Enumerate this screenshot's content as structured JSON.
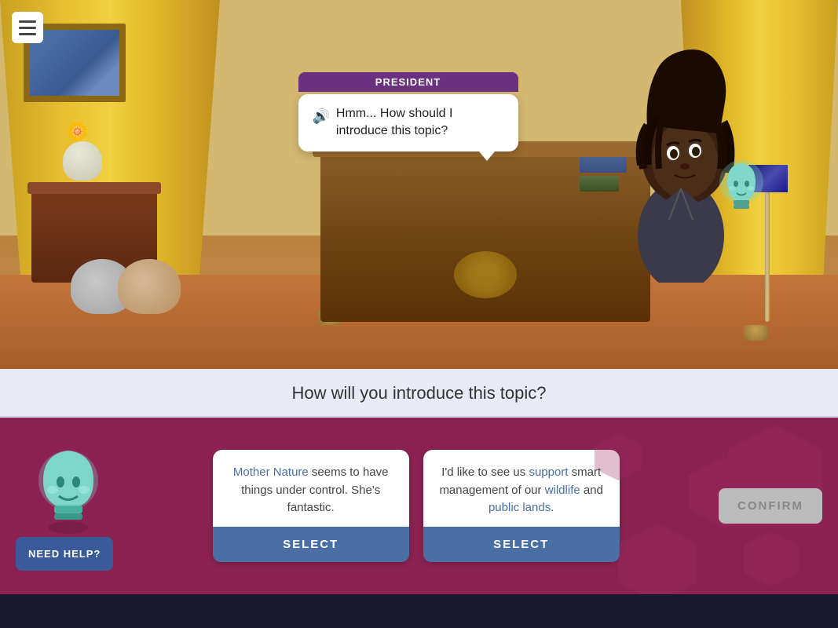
{
  "menu": {
    "label": "☰"
  },
  "scene": {
    "speaker": "PRESIDENT",
    "speech": "Hmm... How should I introduce this topic?",
    "sound_icon": "🔊"
  },
  "question": {
    "text": "How will you introduce this topic?"
  },
  "choices": [
    {
      "id": "choice-1",
      "text_parts": [
        {
          "text": "Mother Nature",
          "link": true
        },
        {
          "text": " seems to have things under control. She's fantastic.",
          "link": false
        }
      ],
      "text_display": "Mother Nature seems to have things under control. She's fantastic.",
      "select_label": "SELECT"
    },
    {
      "id": "choice-2",
      "text_parts": [
        {
          "text": "I'd like to see us ",
          "link": false
        },
        {
          "text": "support",
          "link": true
        },
        {
          "text": " smart management of our ",
          "link": false
        },
        {
          "text": "wildlife",
          "link": true
        },
        {
          "text": " and ",
          "link": false
        },
        {
          "text": "public lands",
          "link": true
        },
        {
          "text": ".",
          "link": false
        }
      ],
      "text_display": "I'd like to see us support smart management of our wildlife and public lands.",
      "select_label": "SELECT"
    }
  ],
  "help_button": {
    "label": "NEED HELP?"
  },
  "confirm_button": {
    "label": "CONFIRM"
  }
}
